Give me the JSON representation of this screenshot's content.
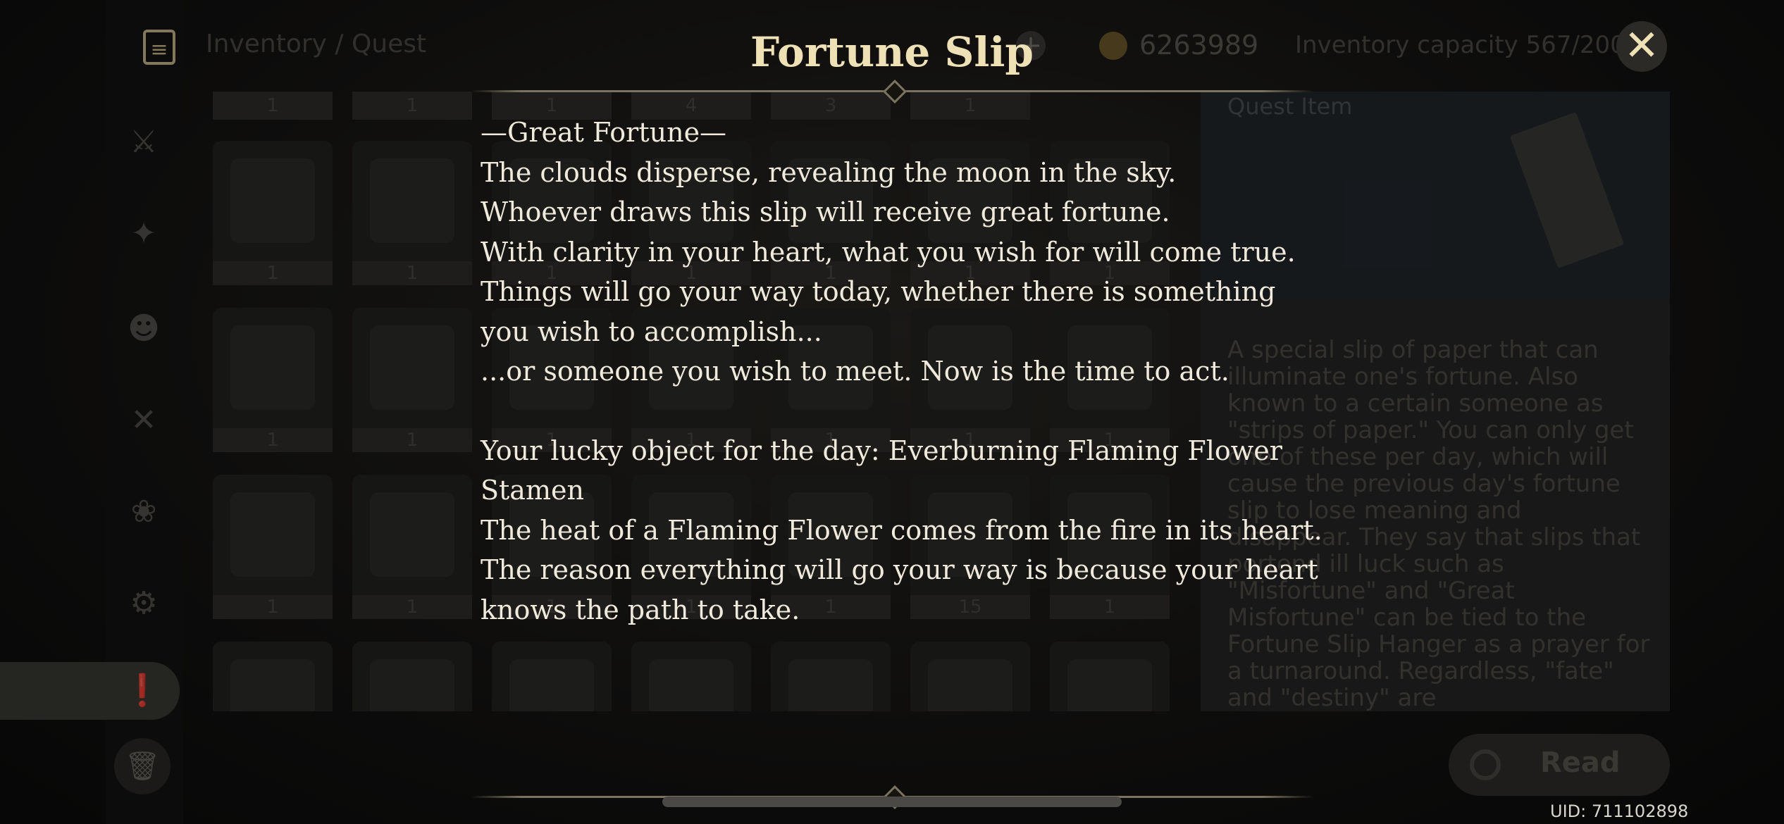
{
  "header": {
    "breadcrumb": "Inventory / Quest",
    "mora": "6263989",
    "capacity": "Inventory capacity 567/2000"
  },
  "dialog": {
    "title": "Fortune Slip",
    "heading": "—Great Fortune—",
    "lines1": [
      "The clouds disperse, revealing the moon in the sky.",
      "Whoever draws this slip will receive great fortune.",
      "With clarity in your heart, what you wish for will come true.",
      "Things will go your way today, whether there is something you wish to accomplish...",
      "...or someone you wish to meet. Now is the time to act."
    ],
    "lines2": [
      "Your lucky object for the day: Everburning Flaming Flower Stamen",
      "The heat of a Flaming Flower comes from the fire in its heart.",
      "The reason everything will go your way is because your heart knows the path to take."
    ]
  },
  "grid": {
    "top_counts": [
      "1",
      "1",
      "1",
      "4",
      "3",
      "1"
    ],
    "row1": [
      "1",
      "1",
      "1",
      "1",
      "1",
      "1",
      "1"
    ],
    "row2": [
      "1",
      "1",
      "1",
      "1",
      "1",
      "1",
      "1"
    ],
    "row3": [
      "1",
      "1",
      "1",
      "1",
      "1",
      "15",
      "1"
    ]
  },
  "detail": {
    "category": "Quest Item",
    "description": "A special slip of paper that can illuminate one's fortune. Also known to a certain someone as \"strips of paper.\" You can only get one of these per day, which will cause the previous day's fortune slip to lose meaning and disappear. They say that slips that portend ill luck such as \"Misfortune\" and \"Great Misfortune\" can be tied to the Fortune Slip Hanger as a prayer for a turnaround. Regardless, \"fate\" and \"destiny\" are"
  },
  "actions": {
    "read": "Read"
  },
  "footer": {
    "uid": "UID: 711102898"
  },
  "icons": {
    "menu": "list-icon",
    "close": "close-icon",
    "coin": "mora-coin-icon",
    "plus": "plus-icon",
    "trash": "trash-icon",
    "sidebar": [
      "sword-icon",
      "artifact-icon",
      "character-icon",
      "food-icon",
      "material-icon",
      "gadget-icon",
      "quest-icon"
    ]
  },
  "colors": {
    "title": "#efe1b6",
    "text": "#f0eadc"
  }
}
